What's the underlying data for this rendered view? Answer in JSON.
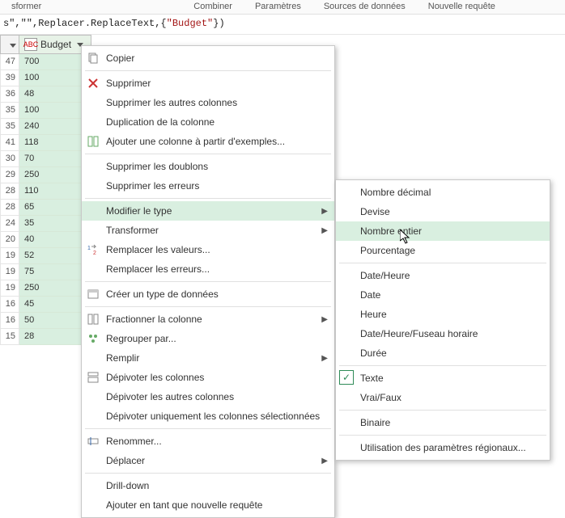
{
  "ribbon": {
    "tabs": [
      "sformer",
      "Combiner",
      "Paramètres",
      "Sources de données",
      "Nouvelle requête"
    ]
  },
  "formula_bar": {
    "prefix": "s\",\"\",Replacer.ReplaceText,{",
    "quoted": "\"Budget\"",
    "suffix": "})"
  },
  "column": {
    "type_label": "ABC",
    "header": "Budget"
  },
  "rows": [
    {
      "n": "47",
      "v": "700"
    },
    {
      "n": "39",
      "v": "100"
    },
    {
      "n": "36",
      "v": "48"
    },
    {
      "n": "35",
      "v": "100"
    },
    {
      "n": "35",
      "v": "240"
    },
    {
      "n": "41",
      "v": "118"
    },
    {
      "n": "30",
      "v": "70"
    },
    {
      "n": "29",
      "v": "250"
    },
    {
      "n": "28",
      "v": "110"
    },
    {
      "n": "28",
      "v": "65"
    },
    {
      "n": "24",
      "v": "35"
    },
    {
      "n": "20",
      "v": "40"
    },
    {
      "n": "19",
      "v": "52"
    },
    {
      "n": "19",
      "v": "75"
    },
    {
      "n": "19",
      "v": "250"
    },
    {
      "n": "16",
      "v": "45"
    },
    {
      "n": "16",
      "v": "50"
    },
    {
      "n": "15",
      "v": "28"
    }
  ],
  "context_menu": {
    "copy": "Copier",
    "remove": "Supprimer",
    "remove_others": "Supprimer les autres colonnes",
    "duplicate": "Duplication de la colonne",
    "add_from_examples": "Ajouter une colonne à partir d'exemples...",
    "remove_dupes": "Supprimer les doublons",
    "remove_errors": "Supprimer les erreurs",
    "change_type": "Modifier le type",
    "transform": "Transformer",
    "replace_values": "Remplacer les valeurs...",
    "replace_errors": "Remplacer les erreurs...",
    "create_datatype": "Créer un type de données",
    "split_column": "Fractionner la colonne",
    "group_by": "Regrouper par...",
    "fill": "Remplir",
    "unpivot": "Dépivoter les colonnes",
    "unpivot_others": "Dépivoter les autres colonnes",
    "unpivot_selected": "Dépivoter uniquement les colonnes sélectionnées",
    "rename": "Renommer...",
    "move": "Déplacer",
    "drill_down": "Drill-down",
    "add_as_query": "Ajouter en tant que nouvelle requête"
  },
  "type_submenu": {
    "decimal": "Nombre décimal",
    "currency": "Devise",
    "whole": "Nombre entier",
    "percent": "Pourcentage",
    "datetime": "Date/Heure",
    "date": "Date",
    "time": "Heure",
    "datetimezone": "Date/Heure/Fuseau horaire",
    "duration": "Durée",
    "text": "Texte",
    "bool": "Vrai/Faux",
    "binary": "Binaire",
    "locale": "Utilisation des paramètres régionaux..."
  }
}
